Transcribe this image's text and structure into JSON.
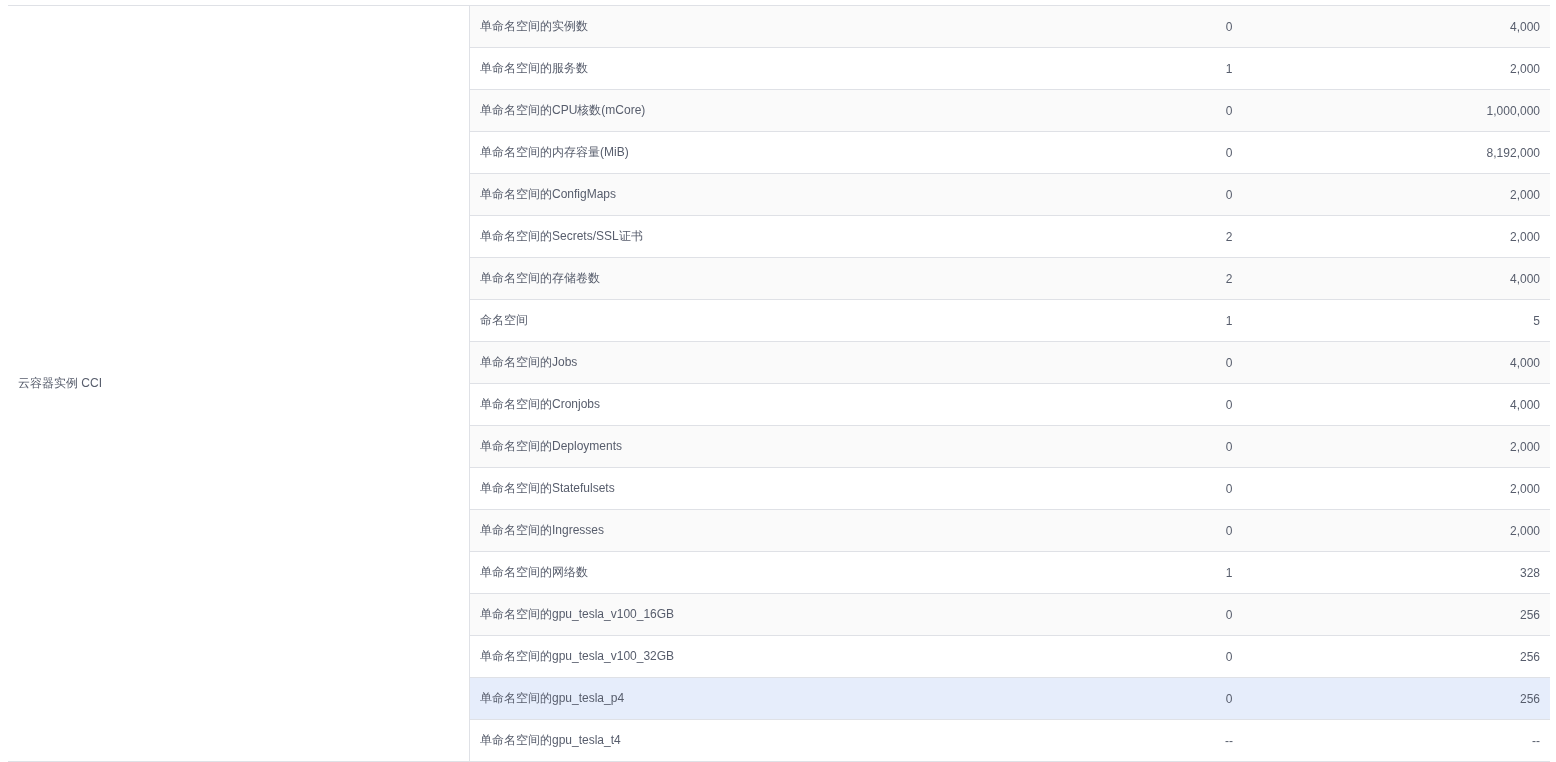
{
  "table": {
    "group": "云容器实例 CCI",
    "rows": [
      {
        "name": "单命名空间的实例数",
        "used": "0",
        "quota": "4,000",
        "highlighted": false
      },
      {
        "name": "单命名空间的服务数",
        "used": "1",
        "quota": "2,000",
        "highlighted": false
      },
      {
        "name": "单命名空间的CPU核数(mCore)",
        "used": "0",
        "quota": "1,000,000",
        "highlighted": false
      },
      {
        "name": "单命名空间的内存容量(MiB)",
        "used": "0",
        "quota": "8,192,000",
        "highlighted": false
      },
      {
        "name": "单命名空间的ConfigMaps",
        "used": "0",
        "quota": "2,000",
        "highlighted": false
      },
      {
        "name": "单命名空间的Secrets/SSL证书",
        "used": "2",
        "quota": "2,000",
        "highlighted": false
      },
      {
        "name": "单命名空间的存储卷数",
        "used": "2",
        "quota": "4,000",
        "highlighted": false
      },
      {
        "name": "命名空间",
        "used": "1",
        "quota": "5",
        "highlighted": false
      },
      {
        "name": "单命名空间的Jobs",
        "used": "0",
        "quota": "4,000",
        "highlighted": false
      },
      {
        "name": "单命名空间的Cronjobs",
        "used": "0",
        "quota": "4,000",
        "highlighted": false
      },
      {
        "name": "单命名空间的Deployments",
        "used": "0",
        "quota": "2,000",
        "highlighted": false
      },
      {
        "name": "单命名空间的Statefulsets",
        "used": "0",
        "quota": "2,000",
        "highlighted": false
      },
      {
        "name": "单命名空间的Ingresses",
        "used": "0",
        "quota": "2,000",
        "highlighted": false
      },
      {
        "name": "单命名空间的网络数",
        "used": "1",
        "quota": "328",
        "highlighted": false
      },
      {
        "name": "单命名空间的gpu_tesla_v100_16GB",
        "used": "0",
        "quota": "256",
        "highlighted": false
      },
      {
        "name": "单命名空间的gpu_tesla_v100_32GB",
        "used": "0",
        "quota": "256",
        "highlighted": false
      },
      {
        "name": "单命名空间的gpu_tesla_p4",
        "used": "0",
        "quota": "256",
        "highlighted": true
      },
      {
        "name": "单命名空间的gpu_tesla_t4",
        "used": "--",
        "quota": "--",
        "highlighted": false
      }
    ]
  }
}
